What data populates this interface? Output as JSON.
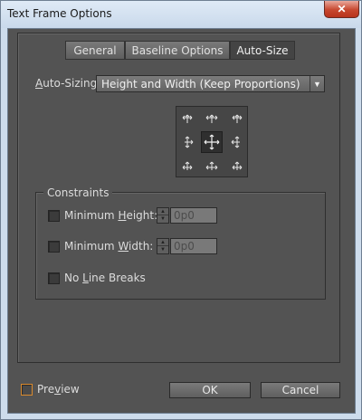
{
  "window": {
    "title": "Text Frame Options",
    "close_glyph": "✕"
  },
  "tabs": [
    {
      "label": "General",
      "active": false
    },
    {
      "label": "Baseline Options",
      "active": false
    },
    {
      "label": "Auto-Size",
      "active": true
    }
  ],
  "auto_sizing": {
    "label_u": "A",
    "label_rest": "uto-Sizing",
    "value": "Height and Width (Keep Proportions)",
    "arrow": "▼"
  },
  "reference_point": {
    "icon": "move-arrows-icon"
  },
  "constraints": {
    "title": "Constraints",
    "min_height": {
      "label_pre": "Minimum ",
      "label_u": "H",
      "label_post": "eight:",
      "value": "0p0",
      "checked": false
    },
    "min_width": {
      "label_pre": "Minimum ",
      "label_u": "W",
      "label_post": "idth:",
      "value": "0p0",
      "checked": false
    },
    "no_line_breaks": {
      "label_pre": "No ",
      "label_u": "L",
      "label_post": "ine Breaks",
      "checked": false
    }
  },
  "footer": {
    "preview_pre": "Pre",
    "preview_u": "v",
    "preview_post": "iew",
    "ok_label": "OK",
    "cancel_label": "Cancel"
  },
  "colors": {
    "panel_bg": "#535353",
    "accent_orange": "#d98a2e"
  }
}
